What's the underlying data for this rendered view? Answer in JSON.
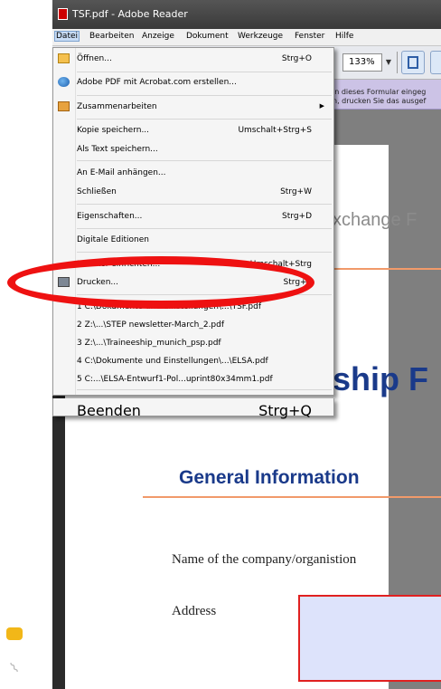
{
  "window": {
    "title": "TSF.pdf - Adobe Reader"
  },
  "menubar": [
    "Datei",
    "Bearbeiten",
    "Anzeige",
    "Dokument",
    "Werkzeuge",
    "Fenster",
    "Hilfe"
  ],
  "toolbar": {
    "zoom": "133%"
  },
  "formbar": {
    "line1": "in dieses Formular eingeg",
    "line2": "n, drucken Sie das ausgef"
  },
  "menu": {
    "open": {
      "label": "Öffnen...",
      "shortcut": "Strg+O"
    },
    "acrobat": {
      "label": "Adobe PDF mit Acrobat.com erstellen..."
    },
    "collab": {
      "label": "Zusammenarbeiten"
    },
    "save_copy": {
      "label": "Kopie speichern...",
      "shortcut": "Umschalt+Strg+S"
    },
    "save_text": {
      "label": "Als Text speichern..."
    },
    "email": {
      "label": "An E-Mail anhängen..."
    },
    "close": {
      "label": "Schließen",
      "shortcut": "Strg+W"
    },
    "properties": {
      "label": "Eigenschaften...",
      "shortcut": "Strg+D"
    },
    "digital": {
      "label": "Digitale Editionen"
    },
    "printer_setup": {
      "label": "Drucker einrichten...",
      "shortcut": "Umschalt+Strg"
    },
    "print": {
      "label": "Drucken...",
      "shortcut": "Strg+P"
    },
    "recent": [
      "1 C:\\Dokumente und Einstellungen\\...\\TSF.pdf",
      "2 Z:\\...\\STEP newsletter-March_2.pdf",
      "3 Z:\\...\\Traineeship_munich_psp.pdf",
      "4 C:\\Dokumente und Einstellungen\\...\\ELSA.pdf",
      "5 C:...\\ELSA-Entwurf1-Pol...uprint80x34mm1.pdf"
    ],
    "exit": {
      "label": "Beenden",
      "shortcut": "Strg+Q"
    }
  },
  "document": {
    "exchange_text": "xchange F",
    "title_fragment": "ship F",
    "section_heading": "General Information",
    "company_label": "Name of the company/organistion",
    "address_label": "Address"
  },
  "colors": {
    "highlight_ellipse": "#ee1111",
    "heading_blue": "#1a3a8a",
    "rule_orange": "#f19a6a",
    "form_field": "#dde3fb"
  }
}
